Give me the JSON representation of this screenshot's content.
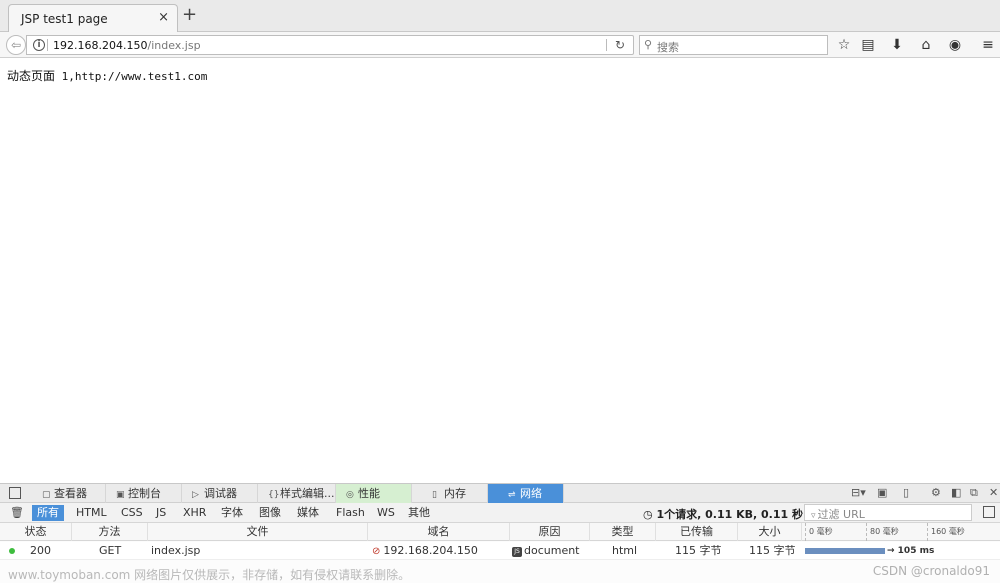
{
  "tabs": [
    {
      "title": "JSP test1 page",
      "close": "×"
    }
  ],
  "new_tab": "+",
  "navbar": {
    "url_host": "192.168.204.150",
    "url_path": "/index.jsp",
    "search_placeholder": "搜索"
  },
  "page": {
    "text_cn": "动态页面",
    "text_mono": " 1,http://www.test1.com"
  },
  "devtools": {
    "tabs": [
      {
        "label": "查看器",
        "icon": "inspector-icon"
      },
      {
        "label": "控制台",
        "icon": "console-icon"
      },
      {
        "label": "调试器",
        "icon": "debugger-icon"
      },
      {
        "label": "样式编辑...",
        "icon": "style-editor-icon"
      },
      {
        "label": "性能",
        "icon": "performance-icon"
      },
      {
        "label": "内存",
        "icon": "memory-icon"
      },
      {
        "label": "网络",
        "icon": "network-icon",
        "active": true
      }
    ],
    "filters": [
      "所有",
      "HTML",
      "CSS",
      "JS",
      "XHR",
      "字体",
      "图像",
      "媒体",
      "Flash",
      "WS",
      "其他"
    ],
    "active_filter": "所有",
    "summary": "1个请求, 0.11 KB, 0.11 秒",
    "url_filter_placeholder": "过滤 URL",
    "columns": [
      "状态",
      "方法",
      "文件",
      "域名",
      "原因",
      "类型",
      "已传输",
      "大小"
    ],
    "timeline_ticks": [
      "0 毫秒",
      "80 毫秒",
      "160 毫秒"
    ],
    "requests": [
      {
        "status": "200",
        "method": "GET",
        "file": "index.jsp",
        "domain": "192.168.204.150",
        "cause": "document",
        "type": "html",
        "transferred": "115 字节",
        "size": "115 字节",
        "timing": "→ 105 ms"
      }
    ]
  },
  "watermark": {
    "left": "www.toymoban.com 网络图片仅供展示，非存储，如有侵权请联系删除。",
    "right": "CSDN @cronaldo91"
  },
  "colors": {
    "active_tab": "#4a90d9",
    "performance_tab": "#d6efd1",
    "status_ok": "#3ebd3e",
    "waterfall": "#6b8fbf"
  }
}
